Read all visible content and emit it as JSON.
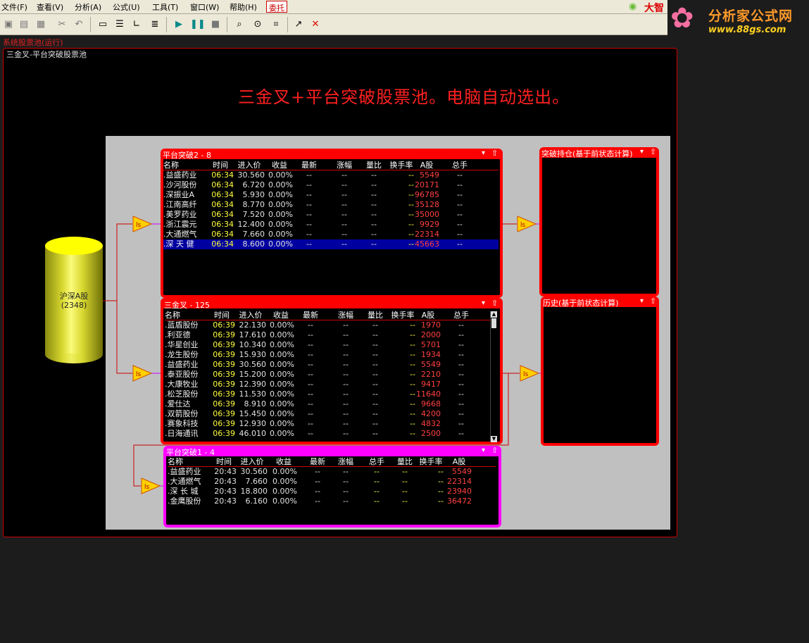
{
  "menubar": {
    "items": [
      "文件(F)",
      "查看(V)",
      "分析(A)",
      "公式(U)",
      "工具(T)",
      "窗口(W)",
      "帮助(H)"
    ],
    "entrust": "委托",
    "right_text": "大智"
  },
  "logo": {
    "line1": "分析家公式网",
    "line2": "www.88gs.com"
  },
  "pool": {
    "title": "系统股票池(运行)",
    "frame_label": "三金叉-平台突破股票池",
    "banner": "三金叉+平台突破股票池。电脑自动选出。"
  },
  "source": {
    "name": "沪深A股",
    "count": "(2348)"
  },
  "panels": {
    "breakout2": {
      "title": "平台突破2 - 8",
      "headers": [
        "名称",
        "时间",
        "进入价",
        "收益",
        "最新",
        "涨幅",
        "量比",
        "换手率",
        "A股",
        "总手"
      ],
      "rows": [
        [
          "益盛药业",
          "06:34",
          "30.560",
          "0.00%",
          "--",
          "--",
          "--",
          "--",
          "5549",
          "--"
        ],
        [
          "沙河股份",
          "06:34",
          "6.720",
          "0.00%",
          "--",
          "--",
          "--",
          "--",
          "20171",
          "--"
        ],
        [
          "深振业A",
          "06:34",
          "5.930",
          "0.00%",
          "--",
          "--",
          "--",
          "--",
          "96785",
          "--"
        ],
        [
          "江南高纤",
          "06:34",
          "8.770",
          "0.00%",
          "--",
          "--",
          "--",
          "--",
          "35128",
          "--"
        ],
        [
          "美罗药业",
          "06:34",
          "7.520",
          "0.00%",
          "--",
          "--",
          "--",
          "--",
          "35000",
          "--"
        ],
        [
          "浙江震元",
          "06:34",
          "12.400",
          "0.00%",
          "--",
          "--",
          "--",
          "--",
          "9929",
          "--"
        ],
        [
          "大通燃气",
          "06:34",
          "7.660",
          "0.00%",
          "--",
          "--",
          "--",
          "--",
          "22314",
          "--"
        ],
        [
          "深 天 健",
          "06:34",
          "8.600",
          "0.00%",
          "--",
          "--",
          "--",
          "--",
          "45663",
          "--"
        ]
      ]
    },
    "golden": {
      "title": "三金叉 - 125",
      "headers": [
        "名称",
        "时间",
        "进入价",
        "收益",
        "最新",
        "涨幅",
        "量比",
        "换手率",
        "A股",
        "总手"
      ],
      "rows": [
        [
          "蓝盾股份",
          "06:39",
          "22.130",
          "0.00%",
          "--",
          "--",
          "--",
          "--",
          "1970",
          "--"
        ],
        [
          "利亚德",
          "06:39",
          "17.610",
          "0.00%",
          "--",
          "--",
          "--",
          "--",
          "2000",
          "--"
        ],
        [
          "华星创业",
          "06:39",
          "10.340",
          "0.00%",
          "--",
          "--",
          "--",
          "--",
          "5701",
          "--"
        ],
        [
          "龙生股份",
          "06:39",
          "15.930",
          "0.00%",
          "--",
          "--",
          "--",
          "--",
          "1934",
          "--"
        ],
        [
          "益盛药业",
          "06:39",
          "30.560",
          "0.00%",
          "--",
          "--",
          "--",
          "--",
          "5549",
          "--"
        ],
        [
          "泰亚股份",
          "06:39",
          "15.200",
          "0.00%",
          "--",
          "--",
          "--",
          "--",
          "2210",
          "--"
        ],
        [
          "大康牧业",
          "06:39",
          "12.390",
          "0.00%",
          "--",
          "--",
          "--",
          "--",
          "9417",
          "--"
        ],
        [
          "松芝股份",
          "06:39",
          "11.530",
          "0.00%",
          "--",
          "--",
          "--",
          "--",
          "11640",
          "--"
        ],
        [
          "爱仕达",
          "06:39",
          "8.910",
          "0.00%",
          "--",
          "--",
          "--",
          "--",
          "9668",
          "--"
        ],
        [
          "双箭股份",
          "06:39",
          "15.450",
          "0.00%",
          "--",
          "--",
          "--",
          "--",
          "4200",
          "--"
        ],
        [
          "赛象科技",
          "06:39",
          "12.930",
          "0.00%",
          "--",
          "--",
          "--",
          "--",
          "4832",
          "--"
        ],
        [
          "日海通讯",
          "06:39",
          "46.010",
          "0.00%",
          "--",
          "--",
          "--",
          "--",
          "2500",
          "--"
        ]
      ]
    },
    "breakout1": {
      "title": "平台突破1 - 4",
      "headers": [
        "名称",
        "时间",
        "进入价",
        "收益",
        "最新",
        "涨幅",
        "总手",
        "量比",
        "换手率",
        "A股"
      ],
      "rows": [
        [
          "益盛药业",
          "20:43",
          "30.560",
          "0.00%",
          "--",
          "--",
          "--",
          "--",
          "--",
          "5549"
        ],
        [
          "大通燃气",
          "20:43",
          "7.660",
          "0.00%",
          "--",
          "--",
          "--",
          "--",
          "--",
          "22314"
        ],
        [
          "深 长 城",
          "20:43",
          "18.800",
          "0.00%",
          "--",
          "--",
          "--",
          "--",
          "--",
          "23940"
        ],
        [
          "金鹰股份",
          "20:43",
          "6.160",
          "0.00%",
          "--",
          "--",
          "--",
          "--",
          "--",
          "36472"
        ]
      ]
    },
    "holding": {
      "title": "突破持仓(基于前状态计算)"
    },
    "history": {
      "title": "历史(基于前状态计算)"
    }
  },
  "colors": {
    "frame_red": "#ff0000",
    "frame_magenta": "#ff00ff",
    "canvas_gray": "#c0c0c0",
    "selected_row": "#0000a0"
  },
  "icons": [
    "new-icon",
    "open-icon",
    "save-icon",
    "cut-icon",
    "undo-icon",
    "layout-icon",
    "play-icon",
    "pause-icon",
    "stop-icon",
    "find-icon",
    "lock-icon",
    "chart-icon",
    "export-icon",
    "close-icon"
  ]
}
